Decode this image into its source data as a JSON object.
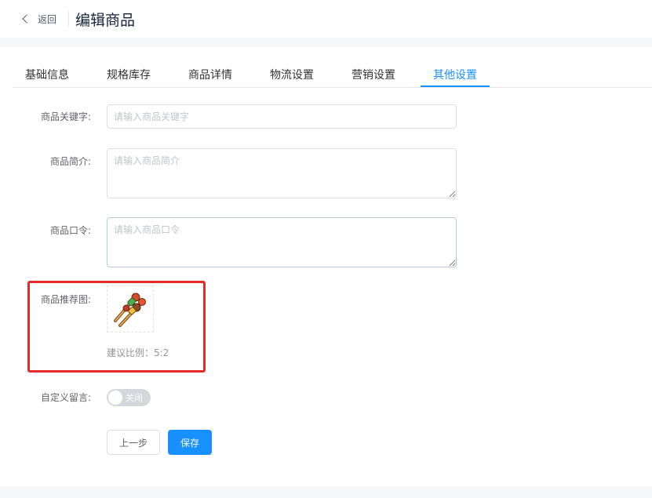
{
  "header": {
    "back_label": "返回",
    "title": "编辑商品"
  },
  "tabs": [
    {
      "label": "基础信息"
    },
    {
      "label": "规格库存"
    },
    {
      "label": "商品详情"
    },
    {
      "label": "物流设置"
    },
    {
      "label": "营销设置"
    },
    {
      "label": "其他设置",
      "active": true
    }
  ],
  "form": {
    "keyword": {
      "label": "商品关键字:",
      "placeholder": "请输入商品关键字",
      "value": ""
    },
    "intro": {
      "label": "商品简介:",
      "placeholder": "请输入商品简介",
      "value": ""
    },
    "password": {
      "label": "商品口令:",
      "placeholder": "请输入商品口令",
      "value": ""
    },
    "recommend_image": {
      "label": "商品推荐图:",
      "hint": "建议比例：5:2",
      "image": "skewer-icon"
    },
    "custom_message": {
      "label": "自定义留言:",
      "switch_text": "关闭",
      "enabled": false
    }
  },
  "actions": {
    "prev_label": "上一步",
    "save_label": "保存"
  },
  "colors": {
    "primary": "#1890ff",
    "highlight": "#e42a2a"
  }
}
